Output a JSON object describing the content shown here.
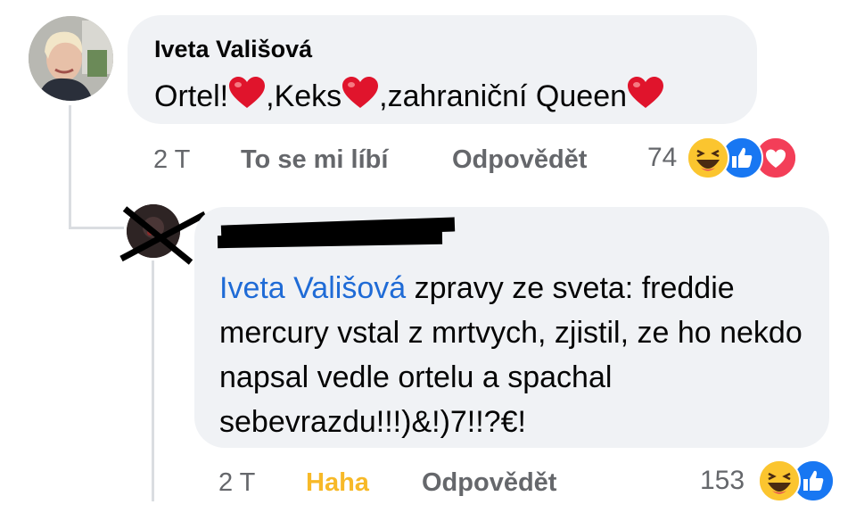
{
  "comment": {
    "author": "Iveta Vališová",
    "text_parts": [
      "Ortel!",
      ",Keks",
      ",zahraniční Queen"
    ],
    "time": "2 T",
    "like_label": "To se mi líbí",
    "reply_label": "Odpovědět",
    "reaction_count": "74",
    "reactions": [
      "haha-icon",
      "like-icon",
      "love-icon"
    ]
  },
  "reply": {
    "author_redacted": true,
    "mention": "Iveta Vališová",
    "text": " zpravy ze sveta: freddie mercury vstal z mrtvych, zjistil, ze ho nekdo napsal vedle ortelu a spachal sebevrazdu!!!)&!)7!!?€!",
    "time": "2 T",
    "reaction_label": "Haha",
    "reaction_label_color": "#f7b928",
    "reply_label": "Odpovědět",
    "reaction_count": "153",
    "reactions": [
      "haha-icon",
      "like-icon"
    ]
  },
  "colors": {
    "mention": "#1f6bd6",
    "meta": "#65676b",
    "bubble": "#f0f2f5",
    "like_blue": "#1877f2",
    "love_red": "#f33e58"
  }
}
